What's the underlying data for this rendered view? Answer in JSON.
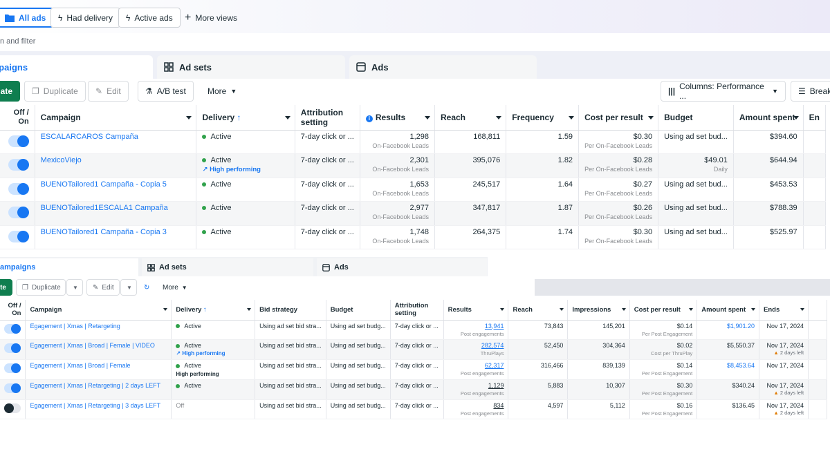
{
  "views": {
    "all_ads": "All ads",
    "had_delivery": "Had delivery",
    "active_ads": "Active ads",
    "more_views": "More views"
  },
  "search": {
    "placeholder": "n and filter"
  },
  "tabs": {
    "campaigns": "Campaigns",
    "ad_sets": "Ad sets",
    "ads": "Ads"
  },
  "toolbar": {
    "create": "ate",
    "duplicate": "Duplicate",
    "edit": "Edit",
    "ab_test": "A/B test",
    "more": "More",
    "columns": "Columns: Performance ...",
    "breakdown": "Break"
  },
  "table1": {
    "headers": {
      "offon": "Off / On",
      "campaign": "Campaign",
      "delivery": "Delivery",
      "attribution": "Attribution setting",
      "results": "Results",
      "reach": "Reach",
      "frequency": "Frequency",
      "cost": "Cost per result",
      "budget": "Budget",
      "spent": "Amount spent",
      "ends": "En"
    },
    "rows": [
      {
        "name": "ESCALARCAROS Campaña",
        "delivery": "Active",
        "attribution": "7-day click or ...",
        "results": "1,298",
        "results_sub": "On-Facebook Leads",
        "reach": "168,811",
        "frequency": "1.59",
        "cost": "$0.30",
        "cost_sub": "Per On-Facebook Leads",
        "budget": "Using ad set bud...",
        "spent": "$394.60"
      },
      {
        "name": "MexicoViejo",
        "delivery": "Active",
        "badge": "High performing",
        "attribution": "7-day click or ...",
        "results": "2,301",
        "results_sub": "On-Facebook Leads",
        "reach": "395,076",
        "frequency": "1.82",
        "cost": "$0.28",
        "cost_sub": "Per On-Facebook Leads",
        "budget": "$49.01",
        "budget_sub": "Daily",
        "spent": "$644.94"
      },
      {
        "name": "BUENOTailored1 Campaña - Copia 5",
        "delivery": "Active",
        "attribution": "7-day click or ...",
        "results": "1,653",
        "results_sub": "On-Facebook Leads",
        "reach": "245,517",
        "frequency": "1.64",
        "cost": "$0.27",
        "cost_sub": "Per On-Facebook Leads",
        "budget": "Using ad set bud...",
        "spent": "$453.53"
      },
      {
        "name": "BUENOTailored1ESCALA1 Campaña",
        "delivery": "Active",
        "attribution": "7-day click or ...",
        "results": "2,977",
        "results_sub": "On-Facebook Leads",
        "reach": "347,817",
        "frequency": "1.87",
        "cost": "$0.26",
        "cost_sub": "Per On-Facebook Leads",
        "budget": "Using ad set bud...",
        "spent": "$788.39"
      },
      {
        "name": "BUENOTailored1 Campaña - Copia 3",
        "delivery": "Active",
        "attribution": "7-day click or ...",
        "results": "1,748",
        "results_sub": "On-Facebook Leads",
        "reach": "264,375",
        "frequency": "1.74",
        "cost": "$0.30",
        "cost_sub": "Per On-Facebook Leads",
        "budget": "Using ad set bud...",
        "spent": "$525.97"
      }
    ]
  },
  "tabs2": {
    "campaigns": "ampaigns",
    "ad_sets": "Ad sets",
    "ads": "Ads"
  },
  "toolbar2": {
    "create": "te",
    "duplicate": "Duplicate",
    "edit": "Edit",
    "more": "More"
  },
  "table2": {
    "headers": {
      "offon": "Off / On",
      "campaign": "Campaign",
      "delivery": "Delivery",
      "bid": "Bid strategy",
      "budget": "Budget",
      "attribution": "Attribution setting",
      "results": "Results",
      "reach": "Reach",
      "impressions": "Impressions",
      "cost": "Cost per result",
      "spent": "Amount spent",
      "ends": "Ends"
    },
    "rows": [
      {
        "name": "Egagement | Xmas | Retargeting",
        "on": true,
        "delivery": "Active",
        "bid": "Using ad set bid stra...",
        "budget": "Using ad set budg...",
        "attribution": "7-day click or ...",
        "results": "13,941",
        "results_sub": "Post engagements",
        "reach": "73,843",
        "impressions": "145,201",
        "cost": "$0.14",
        "cost_sub": "Per Post Engagement",
        "spent": "$1,901.20",
        "spent_link": true,
        "ends": "Nov 17, 2024",
        "warn": ""
      },
      {
        "name": "Egagement | Xmas | Broad | Female | VIDEO",
        "on": true,
        "delivery": "Active",
        "badge": "High performing",
        "bid": "Using ad set bid stra...",
        "budget": "Using ad set budg...",
        "attribution": "7-day click or ...",
        "results": "282,574",
        "results_sub": "ThruPlays",
        "reach": "52,450",
        "impressions": "304,364",
        "cost": "$0.02",
        "cost_sub": "Cost per ThruPlay",
        "spent": "$5,550.37",
        "spent_link": false,
        "ends": "Nov 17, 2024",
        "warn": "2 days left"
      },
      {
        "name": "Egagement | Xmas | Broad | Female",
        "on": true,
        "delivery": "Active",
        "badge2": "High performing",
        "bid": "Using ad set bid stra...",
        "budget": "Using ad set budg...",
        "attribution": "7-day click or ...",
        "results": "62,317",
        "results_sub": "Post engagements",
        "reach": "316,466",
        "impressions": "839,139",
        "cost": "$0.14",
        "cost_sub": "Per Post Engagement",
        "spent": "$8,453.64",
        "spent_link": true,
        "ends": "Nov 17, 2024",
        "warn": ""
      },
      {
        "name": "Egagement | Xmas | Retargeting | 2 days LEFT",
        "on": true,
        "delivery": "Active",
        "bid": "Using ad set bid stra...",
        "budget": "Using ad set budg...",
        "attribution": "7-day click or ...",
        "results": "1,129",
        "results_sub": "Post engagements",
        "reach": "5,883",
        "impressions": "10,307",
        "cost": "$0.30",
        "cost_sub": "Per Post Engagement",
        "spent": "$340.24",
        "spent_link": false,
        "ends": "Nov 17, 2024",
        "warn": "2 days left"
      },
      {
        "name": "Egagement | Xmas | Retargeting | 3 days LEFT",
        "on": false,
        "delivery": "Off",
        "bid": "Using ad set bid stra...",
        "budget": "Using ad set budg...",
        "attribution": "7-day click or ...",
        "results": "834",
        "results_sub": "Post engagements",
        "reach": "4,597",
        "impressions": "5,112",
        "cost": "$0.16",
        "cost_sub": "Per Post Engagement",
        "spent": "$136.45",
        "spent_link": false,
        "ends": "Nov 17, 2024",
        "warn": "2 days left"
      }
    ]
  }
}
